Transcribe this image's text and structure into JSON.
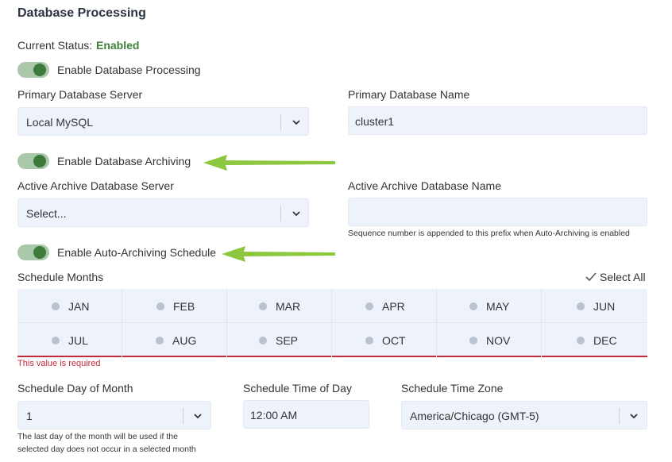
{
  "title": "Database Processing",
  "status": {
    "label": "Current Status:",
    "value": "Enabled"
  },
  "toggles": {
    "processing": "Enable Database Processing",
    "archiving": "Enable Database Archiving",
    "auto_schedule": "Enable Auto-Archiving Schedule"
  },
  "primary": {
    "server_label": "Primary Database Server",
    "server_value": "Local MySQL",
    "name_label": "Primary Database Name",
    "name_value": "cluster1"
  },
  "archive": {
    "server_label": "Active Archive Database Server",
    "server_value": "Select...",
    "name_label": "Active Archive Database Name",
    "name_value": "",
    "name_hint": "Sequence number is appended to this prefix when Auto-Archiving is enabled"
  },
  "schedule": {
    "months_label": "Schedule Months",
    "select_all": "Select All",
    "months": [
      "JAN",
      "FEB",
      "MAR",
      "APR",
      "MAY",
      "JUN",
      "JUL",
      "AUG",
      "SEP",
      "OCT",
      "NOV",
      "DEC"
    ],
    "error": "This value is required",
    "day_label": "Schedule Day of Month",
    "day_value": "1",
    "day_hint_1": "The last day of the month will be used if the",
    "day_hint_2": "selected day does not occur in a selected month",
    "time_label": "Schedule Time of Day",
    "time_value": "12:00 AM",
    "tz_label": "Schedule Time Zone",
    "tz_value": "America/Chicago (GMT-5)"
  },
  "colors": {
    "accent_green": "#3e7a3c",
    "toggle_track": "#a9c7a9",
    "field_bg": "#eef3fb",
    "error_red": "#c22a3c",
    "arrow_green": "#8dc63f"
  }
}
